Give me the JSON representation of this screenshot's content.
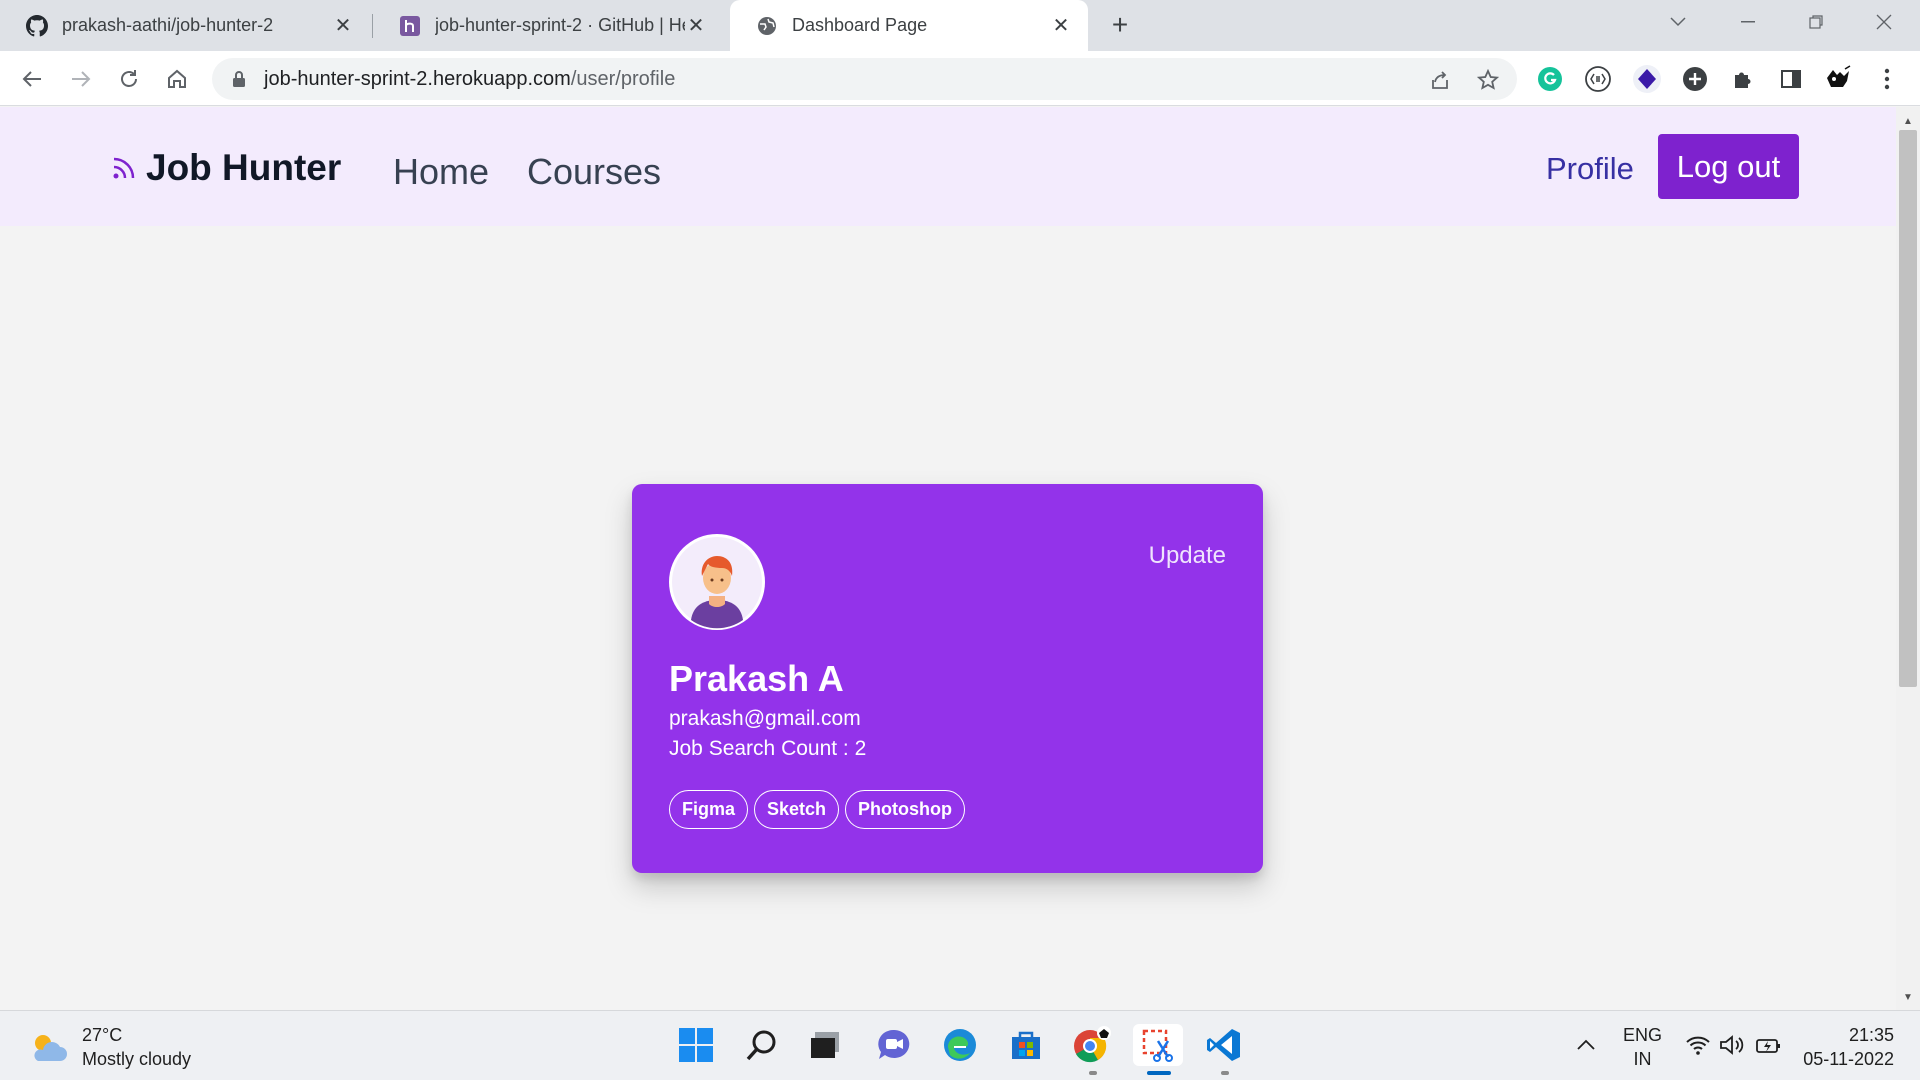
{
  "browser": {
    "tabs": [
      {
        "title": "prakash-aathi/job-hunter-2",
        "icon": "github-icon",
        "active": false
      },
      {
        "title": "job-hunter-sprint-2 · GitHub | He",
        "icon": "heroku-icon",
        "active": false
      },
      {
        "title": "Dashboard Page",
        "icon": "globe-icon",
        "active": true
      }
    ],
    "url_host": "job-hunter-sprint-2.herokuapp.com",
    "url_path": "/user/profile"
  },
  "navbar": {
    "brand": "Job Hunter",
    "links": [
      "Home",
      "Courses"
    ],
    "profile_label": "Profile",
    "logout_label": "Log out",
    "accent": "#7e22ce",
    "background": "#f3ebfd"
  },
  "profile_card": {
    "update_label": "Update",
    "name": "Prakash A",
    "email": "prakash@gmail.com",
    "job_search_count": "Job Search Count : 2",
    "skills": [
      "Figma",
      "Sketch",
      "Photoshop"
    ],
    "color": "#9333ea"
  },
  "taskbar": {
    "weather_temp": "27°C",
    "weather_desc": "Mostly cloudy",
    "lang_line1": "ENG",
    "lang_line2": "IN",
    "time": "21:35",
    "date": "05-11-2022"
  }
}
